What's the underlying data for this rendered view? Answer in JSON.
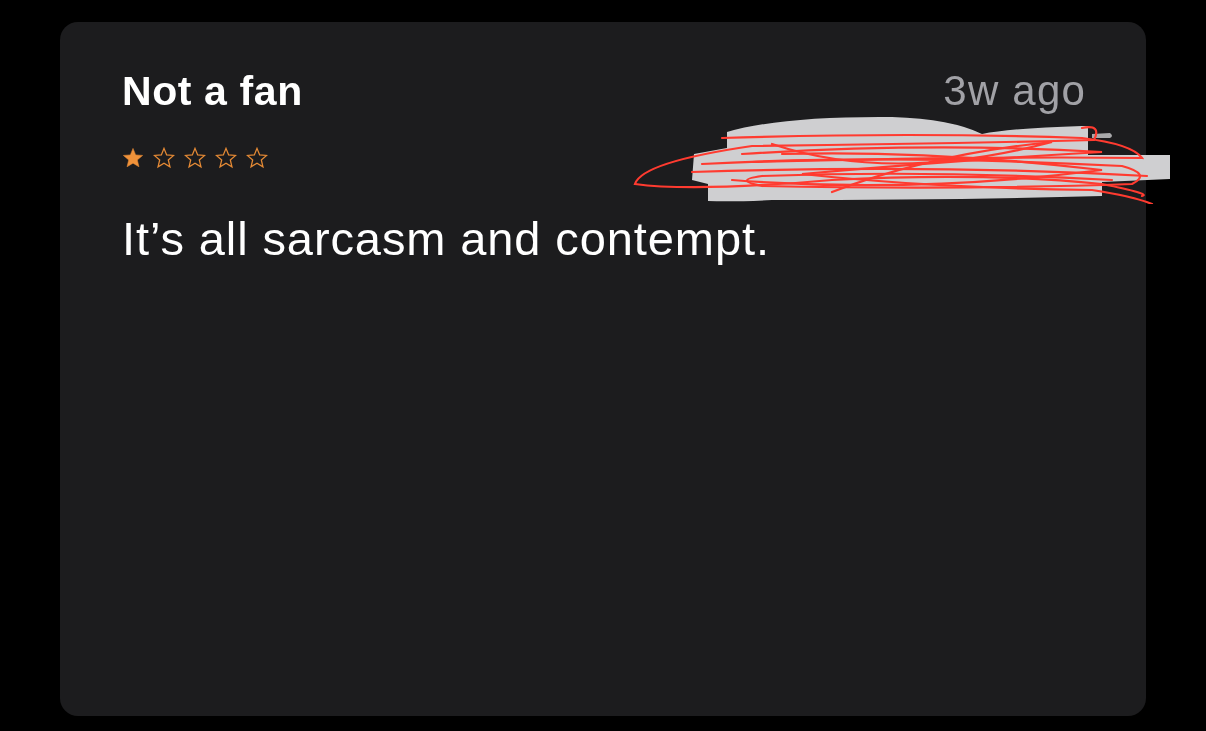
{
  "review": {
    "title": "Not a fan",
    "time": "3w ago",
    "stars": 1,
    "body": "It’s all sarcasm and contempt."
  }
}
